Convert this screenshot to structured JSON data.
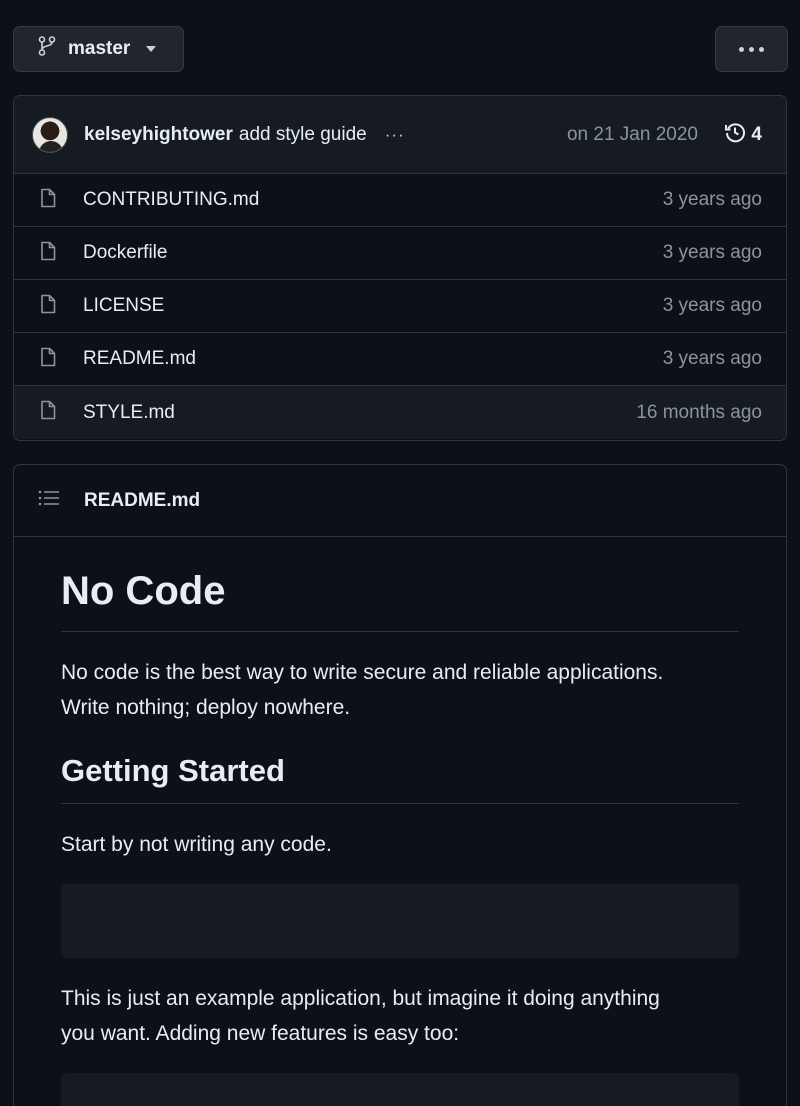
{
  "branch": {
    "label": "master",
    "icon": "git-branch-icon"
  },
  "more_menu": {
    "icon": "kebab-horizontal-icon"
  },
  "commit": {
    "author": "kelseyhightower",
    "message": "add style guide",
    "ellipsis": "···",
    "date": "on 21 Jan 2020",
    "history_count": "4",
    "history_icon": "history-icon"
  },
  "files": [
    {
      "name": "CONTRIBUTING.md",
      "age": "3 years ago",
      "icon": "file-icon"
    },
    {
      "name": "Dockerfile",
      "age": "3 years ago",
      "icon": "file-icon"
    },
    {
      "name": "LICENSE",
      "age": "3 years ago",
      "icon": "file-icon"
    },
    {
      "name": "README.md",
      "age": "3 years ago",
      "icon": "file-icon"
    },
    {
      "name": "STYLE.md",
      "age": "16 months ago",
      "icon": "file-icon"
    }
  ],
  "readme": {
    "title": "README.md",
    "icon": "list-unordered-icon",
    "h1": "No Code",
    "p1_line1": "No code is the best way to write secure and reliable applications.",
    "p1_line2": "Write nothing; deploy nowhere.",
    "h2": "Getting Started",
    "p2": "Start by not writing any code.",
    "p3_line1": "This is just an example application, but imagine it doing anything",
    "p3_line2": "you want. Adding new features is easy too:"
  },
  "colors": {
    "background": "#0d1117",
    "surface": "#161b22",
    "border": "#30363d",
    "text": "#e6edf3",
    "muted": "#8b949e"
  }
}
